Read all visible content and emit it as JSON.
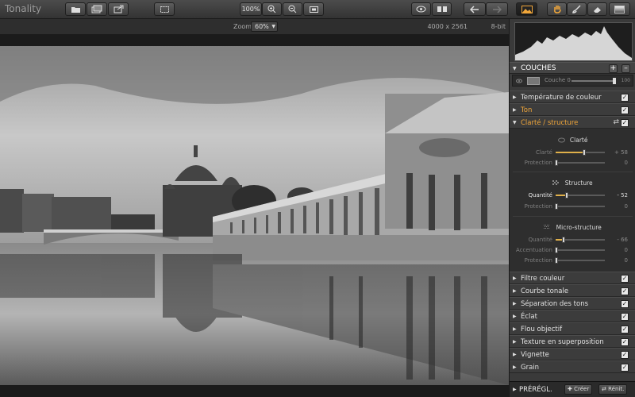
{
  "app": {
    "title": "Tonality"
  },
  "toolbar": {
    "zoom_value": "100%"
  },
  "subbar": {
    "zoom_label": "Zoom",
    "zoom_value": "60%",
    "dimensions": "4000 x 2561",
    "bit_depth": "8-bit"
  },
  "layers": {
    "title": "COUCHES",
    "add_label": "+",
    "remove_label": "–",
    "layer_name": "Couche 0",
    "opacity": "100"
  },
  "sections_top": [
    {
      "label": "Température de couleur",
      "checked": true
    },
    {
      "label": "Ton",
      "checked": true
    },
    {
      "label": "Clarté / structure",
      "checked": true
    }
  ],
  "clarity": {
    "clarte_title": "Clarté",
    "clarte_label": "Clarté",
    "clarte_value": "+ 58",
    "clarte_protection_label": "Protection",
    "clarte_protection_value": "0",
    "structure_title": "Structure",
    "structure_quantity_label": "Quantité",
    "structure_quantity_value": "- 52",
    "structure_protection_label": "Protection",
    "structure_protection_value": "0",
    "micro_title": "Micro-structure",
    "micro_quantity_label": "Quantité",
    "micro_quantity_value": "- 66",
    "micro_accent_label": "Accentuation",
    "micro_accent_value": "0",
    "micro_protection_label": "Protection",
    "micro_protection_value": "0"
  },
  "sections_bottom": [
    {
      "label": "Filtre couleur",
      "checked": true
    },
    {
      "label": "Courbe tonale",
      "checked": true
    },
    {
      "label": "Séparation des tons",
      "checked": true
    },
    {
      "label": "Éclat",
      "checked": true
    },
    {
      "label": "Flou objectif",
      "checked": true
    },
    {
      "label": "Texture en superposition",
      "checked": true
    },
    {
      "label": "Vignette",
      "checked": true
    },
    {
      "label": "Grain",
      "checked": true
    }
  ],
  "presets": {
    "title": "PRÉRÉGL.",
    "create_label": "Créer",
    "reset_label": "Rénit."
  },
  "colors": {
    "accent": "#f0a63a",
    "panel_bg": "#3a3a3a",
    "toolbar_bg": "#3e3e3e"
  }
}
